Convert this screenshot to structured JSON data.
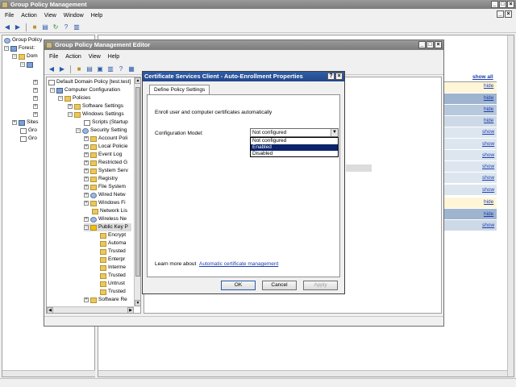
{
  "gpm": {
    "title": "Group Policy Management",
    "menu": [
      "File",
      "Action",
      "View",
      "Window",
      "Help"
    ],
    "tree": {
      "root": "Group Policy",
      "forest": "Forest:",
      "domains": "Dom",
      "sites": "Sites",
      "gro1": "Gro",
      "gro2": "Gro"
    },
    "show_all": "show all",
    "links": [
      "hide",
      "hide",
      "hide",
      "hide",
      "show",
      "show",
      "show",
      "show",
      "show",
      "show",
      "hide",
      "hide",
      "show"
    ]
  },
  "editor": {
    "title": "Group Policy Management Editor",
    "menu": [
      "File",
      "Action",
      "View",
      "Help"
    ],
    "tree": [
      "Default Domain Policy [test.test]",
      "Computer Configuration",
      "Policies",
      "Software Settings",
      "Windows Settings",
      "Scripts (Startup",
      "Security Setting",
      "Account Poli",
      "Local Policie",
      "Event Log",
      "Restricted G",
      "System Serv",
      "Registry",
      "File System",
      "Wired Netw",
      "Windows Fi",
      "Network Lis",
      "Wireless Ne",
      "Public Key P",
      "Encrypt",
      "Automa",
      "Trusted",
      "Enterpr",
      "Interme",
      "Trusted",
      "Untrust",
      "Trusted",
      "Software Re"
    ]
  },
  "dialog": {
    "title": "Certificate Services Client - Auto-Enrollment Properties",
    "tab": "Define Policy Settings",
    "description": "Enroll user and computer certificates automatically",
    "config_label": "Configuration Model:",
    "config_value": "Not configured",
    "options": [
      "Not configured",
      "Enabled",
      "Disabled"
    ],
    "selected_option": "Enabled",
    "learn_prefix": "Learn more about",
    "learn_link": "Automatic certificate management",
    "buttons": {
      "ok": "OK",
      "cancel": "Cancel",
      "apply": "Apply"
    },
    "help_glyph": "?",
    "close_glyph": "×"
  }
}
